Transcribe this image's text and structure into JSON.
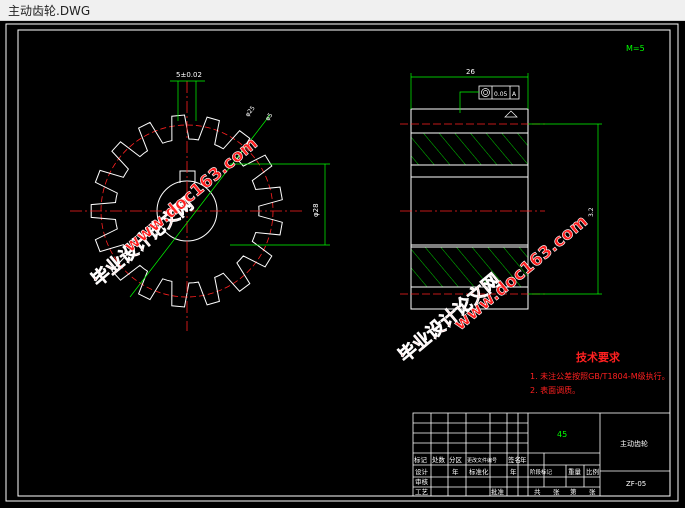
{
  "window": {
    "title": "主动齿轮.DWG"
  },
  "drawing": {
    "scale_note": "M=5",
    "dims": {
      "width_top": "26",
      "keyway": "5±0.02",
      "hub": "φ28",
      "diameter_a": "φ25",
      "diameter_b": "φ5",
      "geometric_tolerance": "0.05",
      "datum": "A",
      "ra": "3.2"
    },
    "watermark": {
      "line1": "毕业设计论文网",
      "line2": "www.doc163.com"
    },
    "requirements": {
      "title": "技术要求",
      "items": [
        "1. 未注公差按照GB/T1804-M级执行。",
        "2. 表面调质。"
      ]
    },
    "title_block": {
      "material": "45",
      "part_name": "主动齿轮",
      "drawing_no": "ZF-05",
      "labels": {
        "mark": "标记",
        "count": "处数",
        "zone": "分区",
        "change_doc": "更改文件编号",
        "sign": "签名",
        "year": "年",
        "month": "月",
        "day": "日",
        "design": "设计",
        "standardize": "标准化",
        "stage_mark": "阶段标记",
        "weight": "重量",
        "scale": "比例",
        "review": "审核",
        "process": "工艺",
        "approve": "批准",
        "total": "共",
        "sheet": "张",
        "page": "第"
      }
    }
  }
}
